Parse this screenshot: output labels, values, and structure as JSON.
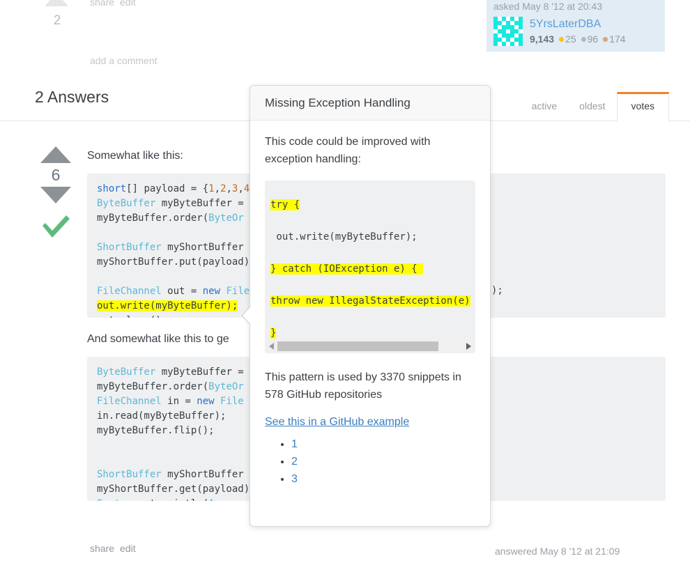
{
  "question_footer": {
    "score": "2",
    "links": [
      "share",
      "edit"
    ],
    "add_comment": "add a comment"
  },
  "asker": {
    "asked": "asked May 8 '12 at 20:43",
    "name": "5YrsLaterDBA",
    "reputation": "9,143",
    "gold": "25",
    "silver": "96",
    "bronze": "174",
    "card_bg": "#e1ecf4",
    "name_color": "#5b9dd9"
  },
  "answers_section": {
    "title": "2 Answers",
    "tabs": [
      {
        "label": "active",
        "active": false
      },
      {
        "label": "oldest",
        "active": false
      },
      {
        "label": "votes",
        "active": true
      }
    ],
    "active_tab_color": "#f48024"
  },
  "answer": {
    "score": "6",
    "accepted": true,
    "accept_color": "#5eba7d",
    "intro_para": "Somewhat like this:",
    "second_para": "And somewhat like this to ge",
    "code_block_1": [
      {
        "segments": [
          {
            "t": "short",
            "c": "k-kw"
          },
          {
            "t": "[] payload = {",
            "c": "k-pl"
          },
          {
            "t": "1",
            "c": "k-num"
          },
          {
            "t": ",",
            "c": "k-pl"
          },
          {
            "t": "2",
            "c": "k-num"
          },
          {
            "t": ",",
            "c": "k-pl"
          },
          {
            "t": "3",
            "c": "k-num"
          },
          {
            "t": ",",
            "c": "k-pl"
          },
          {
            "t": "4",
            "c": "k-num"
          }
        ]
      },
      {
        "segments": [
          {
            "t": "ByteBuffer",
            "c": "k-type"
          },
          {
            "t": " myByteBuffer = ",
            "c": "k-pl"
          }
        ]
      },
      {
        "segments": [
          {
            "t": "myByteBuffer.order(",
            "c": "k-pl"
          },
          {
            "t": "ByteOr",
            "c": "k-type"
          }
        ]
      },
      {
        "segments": [
          {
            "t": "",
            "c": "k-pl"
          }
        ]
      },
      {
        "segments": [
          {
            "t": "ShortBuffer",
            "c": "k-type"
          },
          {
            "t": " myShortBuffer",
            "c": "k-pl"
          }
        ]
      },
      {
        "segments": [
          {
            "t": "myShortBuffer.put(payload)",
            "c": "k-pl"
          }
        ]
      },
      {
        "segments": [
          {
            "t": "",
            "c": "k-pl"
          }
        ]
      },
      {
        "segments": [
          {
            "t": "FileChannel",
            "c": "k-type"
          },
          {
            "t": " out = ",
            "c": "k-pl"
          },
          {
            "t": "new",
            "c": "k-kw"
          },
          {
            "t": " File",
            "c": "k-type"
          }
        ]
      },
      {
        "segments": [
          {
            "t": "out.write(myByteBuffer);",
            "c": "k-pl",
            "hl": true
          }
        ]
      },
      {
        "segments": [
          {
            "t": "out.close();",
            "c": "k-pl"
          }
        ]
      }
    ],
    "code_block_1_right": ");",
    "code_block_2": [
      {
        "segments": [
          {
            "t": "ByteBuffer",
            "c": "k-type"
          },
          {
            "t": " myByteBuffer = ",
            "c": "k-pl"
          }
        ]
      },
      {
        "segments": [
          {
            "t": "myByteBuffer.order(",
            "c": "k-pl"
          },
          {
            "t": "ByteOr",
            "c": "k-type"
          }
        ]
      },
      {
        "segments": [
          {
            "t": "FileChannel",
            "c": "k-type"
          },
          {
            "t": " in = ",
            "c": "k-pl"
          },
          {
            "t": "new",
            "c": "k-kw"
          },
          {
            "t": " File",
            "c": "k-type"
          }
        ]
      },
      {
        "segments": [
          {
            "t": "in.read(myByteBuffer);",
            "c": "k-pl"
          }
        ]
      },
      {
        "segments": [
          {
            "t": "myByteBuffer.flip();",
            "c": "k-pl"
          }
        ]
      },
      {
        "segments": [
          {
            "t": "",
            "c": "k-pl"
          }
        ]
      },
      {
        "segments": [
          {
            "t": "",
            "c": "k-pl"
          }
        ]
      },
      {
        "segments": [
          {
            "t": "ShortBuffer",
            "c": "k-type"
          },
          {
            "t": " myShortBuffer",
            "c": "k-pl"
          }
        ]
      },
      {
        "segments": [
          {
            "t": "myShortBuffer.get(payload)",
            "c": "k-pl"
          }
        ]
      },
      {
        "segments": [
          {
            "t": "System",
            "c": "k-type"
          },
          {
            "t": ".out.println(",
            "c": "k-pl"
          },
          {
            "t": "Arrays",
            "c": "k-type"
          }
        ]
      }
    ],
    "footer_links": [
      "share",
      "edit"
    ],
    "answered": "answered May 8 '12 at 21:09"
  },
  "popup": {
    "title": "Missing Exception Handling",
    "description": "This code could be improved with exception handling:",
    "code_lines": [
      {
        "text": "try {",
        "hl": true
      },
      {
        "text": " out.write(myByteBuffer);",
        "hl": false
      },
      {
        "text": "} catch (IOException e) { ",
        "hl": true
      },
      {
        "text": "throw new IllegalStateException(e)",
        "hl": true
      },
      {
        "text": "}",
        "hl": true
      }
    ],
    "stats": "This pattern is used by 3370 snippets in 578 GitHub repositories",
    "link": "See this in a GitHub example",
    "list_items": [
      "1",
      "2",
      "3"
    ],
    "link_color": "#3a7ebf",
    "highlight_color": "#ffff00",
    "scrollbar": {
      "left_arrow": "◀",
      "right_arrow": "▶"
    }
  }
}
